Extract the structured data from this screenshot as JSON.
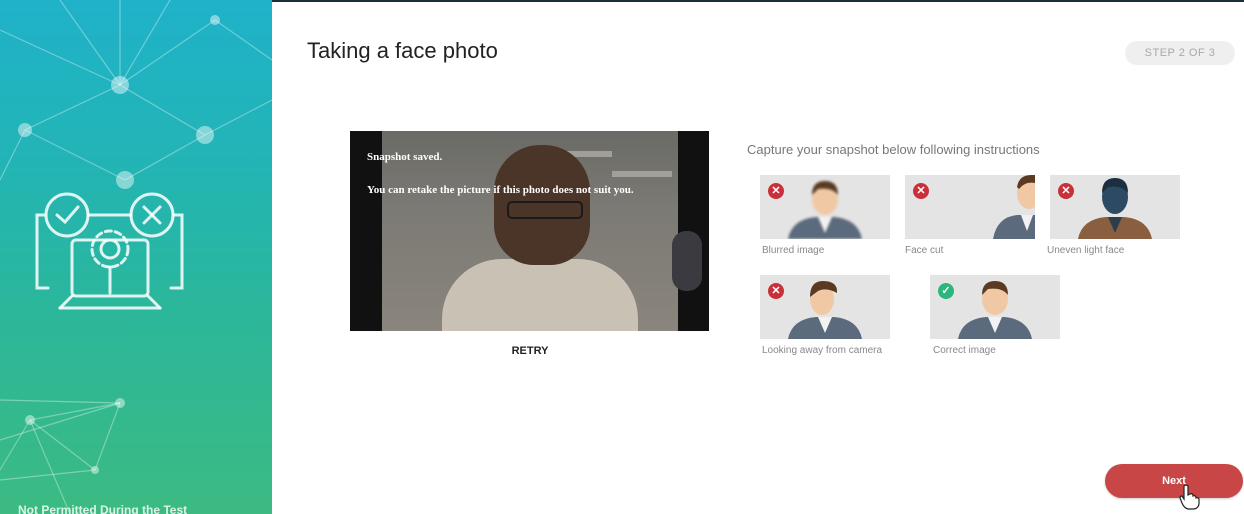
{
  "sidebar": {
    "footer_text": "Not Permitted During the Test",
    "gradient_top": "#1fb2c9",
    "gradient_bottom": "#3cba82",
    "illustration_icons": [
      "check-circle-icon",
      "x-circle-icon",
      "gear-icon",
      "laptop-icon"
    ]
  },
  "header": {
    "title": "Taking a face photo",
    "step": "STEP 2 OF 3"
  },
  "snapshot": {
    "status": "Snapshot saved.",
    "hint": "You can retake the picture if this photo does not suit you.",
    "retry_label": "RETRY"
  },
  "instructions": {
    "title": "Capture your snapshot below following instructions",
    "samples": [
      {
        "label": "Blurred image",
        "status": "bad"
      },
      {
        "label": "Face cut",
        "status": "bad"
      },
      {
        "label": "Uneven light face",
        "status": "bad"
      },
      {
        "label": "Looking away from camera",
        "status": "bad"
      },
      {
        "label": "Correct image",
        "status": "good"
      }
    ]
  },
  "actions": {
    "next_label": "Next",
    "accent": "#c94646"
  },
  "colors": {
    "bad": "#c9303a",
    "good": "#2db67c"
  }
}
